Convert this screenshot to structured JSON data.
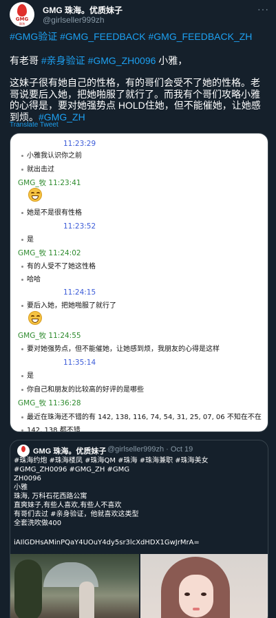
{
  "tweet": {
    "author_name": "GMG 珠海。优质妹子",
    "author_handle": "@girlseller999zh",
    "avatar_logo": "GMG",
    "avatar_sub": "珠海",
    "hashtags_line": "#GMG验证 #GMG_FEEDBACK #GMG_FEEDBACK_ZH",
    "line2_prefix": "有老哥 ",
    "line2_tag1": "#亲身验证",
    "line2_tag2": "#GMG_ZH0096",
    "line2_suffix": " 小雅，",
    "body": "这妹子很有她自己的性格，有的哥们会受不了她的性格。老哥说要后入她，把她啪服了就行了。而我有个哥们攻略小雅的心得是，要对她强势点 HOLD住她，但不能催她，让她感到烦。",
    "body_tag": "#GMG_ZH",
    "translate_label": "Translate Tweet"
  },
  "chat": {
    "rows": [
      {
        "kind": "ts-own",
        "text": "11:23:29"
      },
      {
        "kind": "msg",
        "text": "小雅我认识你之前"
      },
      {
        "kind": "msg",
        "text": "就出击过"
      },
      {
        "kind": "ts-other",
        "text": "GMG_牧   11:23:41"
      },
      {
        "kind": "emoji"
      },
      {
        "kind": "msg",
        "text": "她是不是很有性格"
      },
      {
        "kind": "ts-own",
        "text": "11:23:52"
      },
      {
        "kind": "msg",
        "text": "是"
      },
      {
        "kind": "ts-other",
        "text": "GMG_牧   11:24:02"
      },
      {
        "kind": "msg",
        "text": "有的人受不了她这性格"
      },
      {
        "kind": "msg",
        "text": "哈哈"
      },
      {
        "kind": "ts-own",
        "text": "11:24:15"
      },
      {
        "kind": "msg",
        "text": "要后入她，把她啪服了就行了"
      },
      {
        "kind": "emoji"
      },
      {
        "kind": "ts-other",
        "text": "GMG_牧   11:24:55"
      },
      {
        "kind": "msg",
        "text": "要对她强势点，但不能催她，让她感到烦，我朋友的心得是这样"
      },
      {
        "kind": "ts-own",
        "text": "11:35:14"
      },
      {
        "kind": "msg",
        "text": "是"
      },
      {
        "kind": "msg",
        "text": "你自己和朋友的比较高的好评的是哪些"
      },
      {
        "kind": "ts-other",
        "text": "GMG_牧   11:36:28"
      },
      {
        "kind": "msg",
        "text": "最近在珠海还不错的有 142, 138, 116, 74, 54, 31, 25, 07, 06 不知在不在"
      },
      {
        "kind": "msg",
        "text": "142, 138 都不错"
      }
    ]
  },
  "quote": {
    "author_name": "GMG 珠海。优质妹子",
    "author_handle": "@girlseller999zh · Oct 19",
    "lines": [
      "#珠海约炮 #珠海楼凤 #珠海QM #珠海 #珠海兼职 #珠海美女",
      "#GMG_ZH0096 #GMG_ZH #GMG",
      "ZH0096",
      "小雅",
      "珠海, 万科石花西路公寓",
      "直爽妹子,有些人喜欢,有些人不喜欢",
      "有哥们去过 #亲身验证，他就喜欢这类型",
      "全套洗吹做400"
    ],
    "code": "iAIlGDHsAMinPQaY4UOuY4dy5sr3lcXdHDX1GwJrMrA="
  },
  "colors": {
    "background": "#15202b",
    "link": "#1da1f2",
    "muted": "#8899a6",
    "chat_own_time": "#3b5bd8",
    "chat_other_time": "#2e8b2e"
  }
}
